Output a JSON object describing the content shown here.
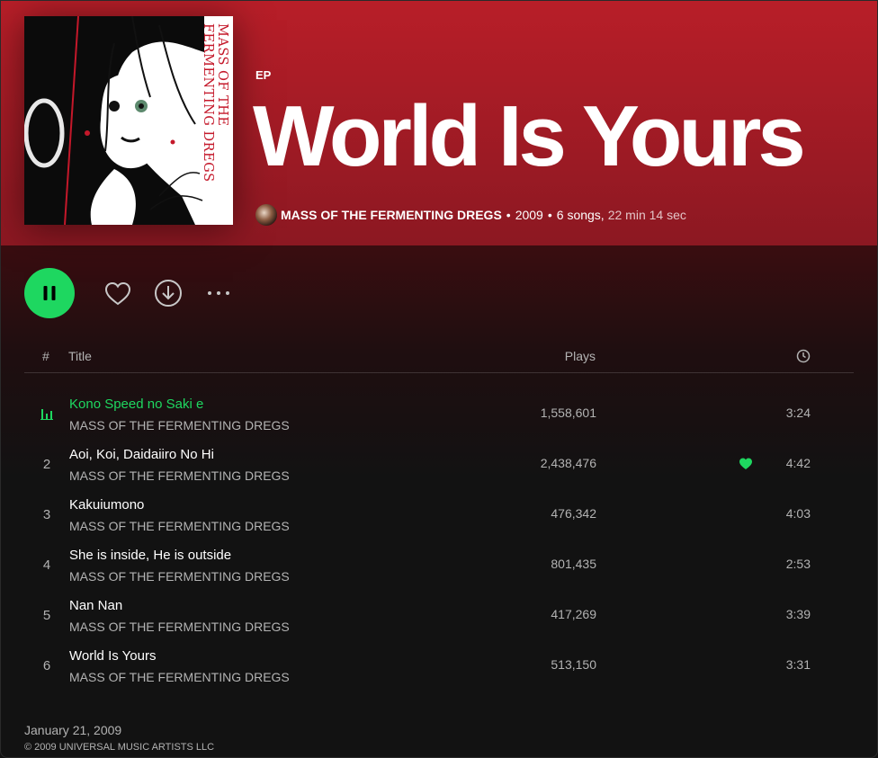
{
  "album": {
    "type_label": "EP",
    "title": "World Is Yours",
    "cover_text": "MASS OF THE FERMENTING DREGS",
    "artist": "MASS OF THE FERMENTING DREGS",
    "year": "2009",
    "song_count": "6 songs,",
    "duration": "22 min 14 sec",
    "release_date": "January 21, 2009",
    "copyright": "© 2009 UNIVERSAL MUSIC ARTISTS LLC"
  },
  "actions": {
    "play_state": "playing",
    "icons": [
      "pause-icon",
      "heart-outline-icon",
      "download-icon",
      "more-icon"
    ]
  },
  "table": {
    "header": {
      "num": "#",
      "title": "Title",
      "plays": "Plays",
      "duration_icon": "clock-icon"
    },
    "tracks": [
      {
        "num": "1",
        "title": "Kono Speed no Saki e",
        "artist": "MASS OF THE FERMENTING DREGS",
        "plays": "1,558,601",
        "duration": "3:24",
        "playing": true,
        "liked": false
      },
      {
        "num": "2",
        "title": "Aoi, Koi, Daidaiiro No Hi",
        "artist": "MASS OF THE FERMENTING DREGS",
        "plays": "2,438,476",
        "duration": "4:42",
        "playing": false,
        "liked": true
      },
      {
        "num": "3",
        "title": "Kakuiumono",
        "artist": "MASS OF THE FERMENTING DREGS",
        "plays": "476,342",
        "duration": "4:03",
        "playing": false,
        "liked": false
      },
      {
        "num": "4",
        "title": "She is inside, He is outside",
        "artist": "MASS OF THE FERMENTING DREGS",
        "plays": "801,435",
        "duration": "2:53",
        "playing": false,
        "liked": false
      },
      {
        "num": "5",
        "title": "Nan Nan",
        "artist": "MASS OF THE FERMENTING DREGS",
        "plays": "417,269",
        "duration": "3:39",
        "playing": false,
        "liked": false
      },
      {
        "num": "6",
        "title": "World Is Yours",
        "artist": "MASS OF THE FERMENTING DREGS",
        "plays": "513,150",
        "duration": "3:31",
        "playing": false,
        "liked": false
      }
    ]
  },
  "colors": {
    "accent": "#1ed760",
    "hero": "#b81e28",
    "background": "#121212",
    "muted": "#b3b3b3"
  }
}
